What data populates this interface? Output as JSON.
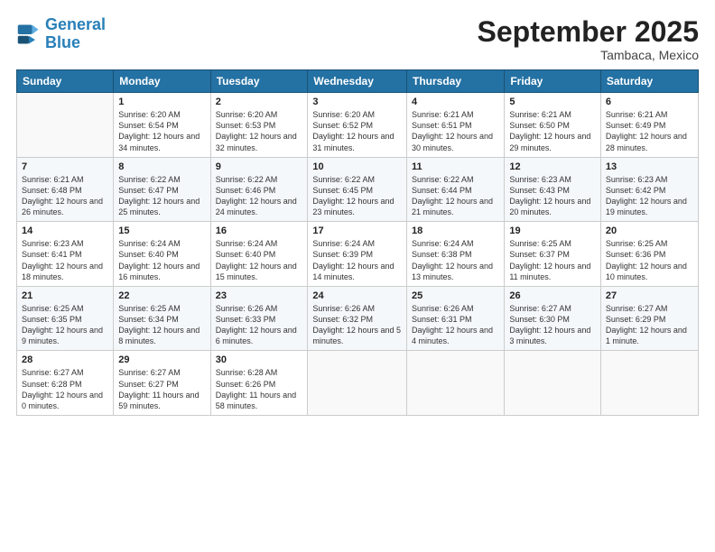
{
  "logo": {
    "line1": "General",
    "line2": "Blue"
  },
  "title": "September 2025",
  "subtitle": "Tambaca, Mexico",
  "header": {
    "days": [
      "Sunday",
      "Monday",
      "Tuesday",
      "Wednesday",
      "Thursday",
      "Friday",
      "Saturday"
    ]
  },
  "weeks": [
    [
      {
        "day": "",
        "sunrise": "",
        "sunset": "",
        "daylight": ""
      },
      {
        "day": "1",
        "sunrise": "Sunrise: 6:20 AM",
        "sunset": "Sunset: 6:54 PM",
        "daylight": "Daylight: 12 hours and 34 minutes."
      },
      {
        "day": "2",
        "sunrise": "Sunrise: 6:20 AM",
        "sunset": "Sunset: 6:53 PM",
        "daylight": "Daylight: 12 hours and 32 minutes."
      },
      {
        "day": "3",
        "sunrise": "Sunrise: 6:20 AM",
        "sunset": "Sunset: 6:52 PM",
        "daylight": "Daylight: 12 hours and 31 minutes."
      },
      {
        "day": "4",
        "sunrise": "Sunrise: 6:21 AM",
        "sunset": "Sunset: 6:51 PM",
        "daylight": "Daylight: 12 hours and 30 minutes."
      },
      {
        "day": "5",
        "sunrise": "Sunrise: 6:21 AM",
        "sunset": "Sunset: 6:50 PM",
        "daylight": "Daylight: 12 hours and 29 minutes."
      },
      {
        "day": "6",
        "sunrise": "Sunrise: 6:21 AM",
        "sunset": "Sunset: 6:49 PM",
        "daylight": "Daylight: 12 hours and 28 minutes."
      }
    ],
    [
      {
        "day": "7",
        "sunrise": "Sunrise: 6:21 AM",
        "sunset": "Sunset: 6:48 PM",
        "daylight": "Daylight: 12 hours and 26 minutes."
      },
      {
        "day": "8",
        "sunrise": "Sunrise: 6:22 AM",
        "sunset": "Sunset: 6:47 PM",
        "daylight": "Daylight: 12 hours and 25 minutes."
      },
      {
        "day": "9",
        "sunrise": "Sunrise: 6:22 AM",
        "sunset": "Sunset: 6:46 PM",
        "daylight": "Daylight: 12 hours and 24 minutes."
      },
      {
        "day": "10",
        "sunrise": "Sunrise: 6:22 AM",
        "sunset": "Sunset: 6:45 PM",
        "daylight": "Daylight: 12 hours and 23 minutes."
      },
      {
        "day": "11",
        "sunrise": "Sunrise: 6:22 AM",
        "sunset": "Sunset: 6:44 PM",
        "daylight": "Daylight: 12 hours and 21 minutes."
      },
      {
        "day": "12",
        "sunrise": "Sunrise: 6:23 AM",
        "sunset": "Sunset: 6:43 PM",
        "daylight": "Daylight: 12 hours and 20 minutes."
      },
      {
        "day": "13",
        "sunrise": "Sunrise: 6:23 AM",
        "sunset": "Sunset: 6:42 PM",
        "daylight": "Daylight: 12 hours and 19 minutes."
      }
    ],
    [
      {
        "day": "14",
        "sunrise": "Sunrise: 6:23 AM",
        "sunset": "Sunset: 6:41 PM",
        "daylight": "Daylight: 12 hours and 18 minutes."
      },
      {
        "day": "15",
        "sunrise": "Sunrise: 6:24 AM",
        "sunset": "Sunset: 6:40 PM",
        "daylight": "Daylight: 12 hours and 16 minutes."
      },
      {
        "day": "16",
        "sunrise": "Sunrise: 6:24 AM",
        "sunset": "Sunset: 6:40 PM",
        "daylight": "Daylight: 12 hours and 15 minutes."
      },
      {
        "day": "17",
        "sunrise": "Sunrise: 6:24 AM",
        "sunset": "Sunset: 6:39 PM",
        "daylight": "Daylight: 12 hours and 14 minutes."
      },
      {
        "day": "18",
        "sunrise": "Sunrise: 6:24 AM",
        "sunset": "Sunset: 6:38 PM",
        "daylight": "Daylight: 12 hours and 13 minutes."
      },
      {
        "day": "19",
        "sunrise": "Sunrise: 6:25 AM",
        "sunset": "Sunset: 6:37 PM",
        "daylight": "Daylight: 12 hours and 11 minutes."
      },
      {
        "day": "20",
        "sunrise": "Sunrise: 6:25 AM",
        "sunset": "Sunset: 6:36 PM",
        "daylight": "Daylight: 12 hours and 10 minutes."
      }
    ],
    [
      {
        "day": "21",
        "sunrise": "Sunrise: 6:25 AM",
        "sunset": "Sunset: 6:35 PM",
        "daylight": "Daylight: 12 hours and 9 minutes."
      },
      {
        "day": "22",
        "sunrise": "Sunrise: 6:25 AM",
        "sunset": "Sunset: 6:34 PM",
        "daylight": "Daylight: 12 hours and 8 minutes."
      },
      {
        "day": "23",
        "sunrise": "Sunrise: 6:26 AM",
        "sunset": "Sunset: 6:33 PM",
        "daylight": "Daylight: 12 hours and 6 minutes."
      },
      {
        "day": "24",
        "sunrise": "Sunrise: 6:26 AM",
        "sunset": "Sunset: 6:32 PM",
        "daylight": "Daylight: 12 hours and 5 minutes."
      },
      {
        "day": "25",
        "sunrise": "Sunrise: 6:26 AM",
        "sunset": "Sunset: 6:31 PM",
        "daylight": "Daylight: 12 hours and 4 minutes."
      },
      {
        "day": "26",
        "sunrise": "Sunrise: 6:27 AM",
        "sunset": "Sunset: 6:30 PM",
        "daylight": "Daylight: 12 hours and 3 minutes."
      },
      {
        "day": "27",
        "sunrise": "Sunrise: 6:27 AM",
        "sunset": "Sunset: 6:29 PM",
        "daylight": "Daylight: 12 hours and 1 minute."
      }
    ],
    [
      {
        "day": "28",
        "sunrise": "Sunrise: 6:27 AM",
        "sunset": "Sunset: 6:28 PM",
        "daylight": "Daylight: 12 hours and 0 minutes."
      },
      {
        "day": "29",
        "sunrise": "Sunrise: 6:27 AM",
        "sunset": "Sunset: 6:27 PM",
        "daylight": "Daylight: 11 hours and 59 minutes."
      },
      {
        "day": "30",
        "sunrise": "Sunrise: 6:28 AM",
        "sunset": "Sunset: 6:26 PM",
        "daylight": "Daylight: 11 hours and 58 minutes."
      },
      {
        "day": "",
        "sunrise": "",
        "sunset": "",
        "daylight": ""
      },
      {
        "day": "",
        "sunrise": "",
        "sunset": "",
        "daylight": ""
      },
      {
        "day": "",
        "sunrise": "",
        "sunset": "",
        "daylight": ""
      },
      {
        "day": "",
        "sunrise": "",
        "sunset": "",
        "daylight": ""
      }
    ]
  ]
}
